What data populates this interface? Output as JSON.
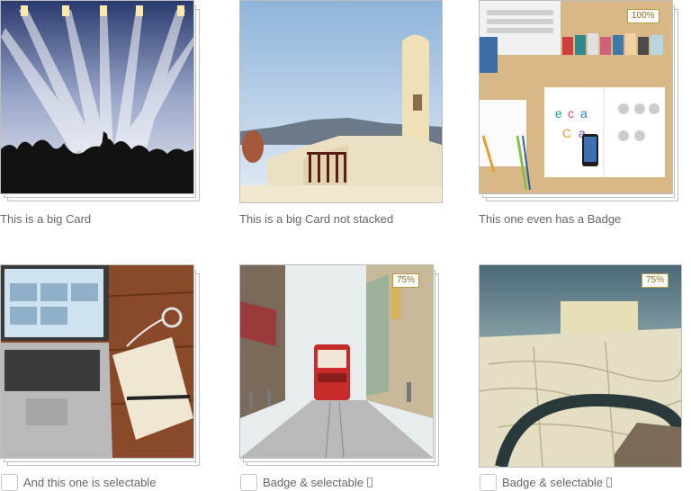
{
  "cards": [
    {
      "caption": "This is a big Card",
      "stacked": true,
      "badge": null,
      "selectable": false
    },
    {
      "caption": "This is a big Card not stacked",
      "stacked": false,
      "badge": null,
      "selectable": false
    },
    {
      "caption": "This one even has a Badge",
      "stacked": true,
      "badge": "100%",
      "selectable": false
    },
    {
      "caption": "And this one is selectable",
      "stacked": true,
      "badge": null,
      "selectable": true
    },
    {
      "caption": "Badge & selectable",
      "stacked": true,
      "badge": "75%",
      "selectable": true
    },
    {
      "caption": "Badge & selectable",
      "stacked": false,
      "badge": "75%",
      "selectable": true
    }
  ]
}
